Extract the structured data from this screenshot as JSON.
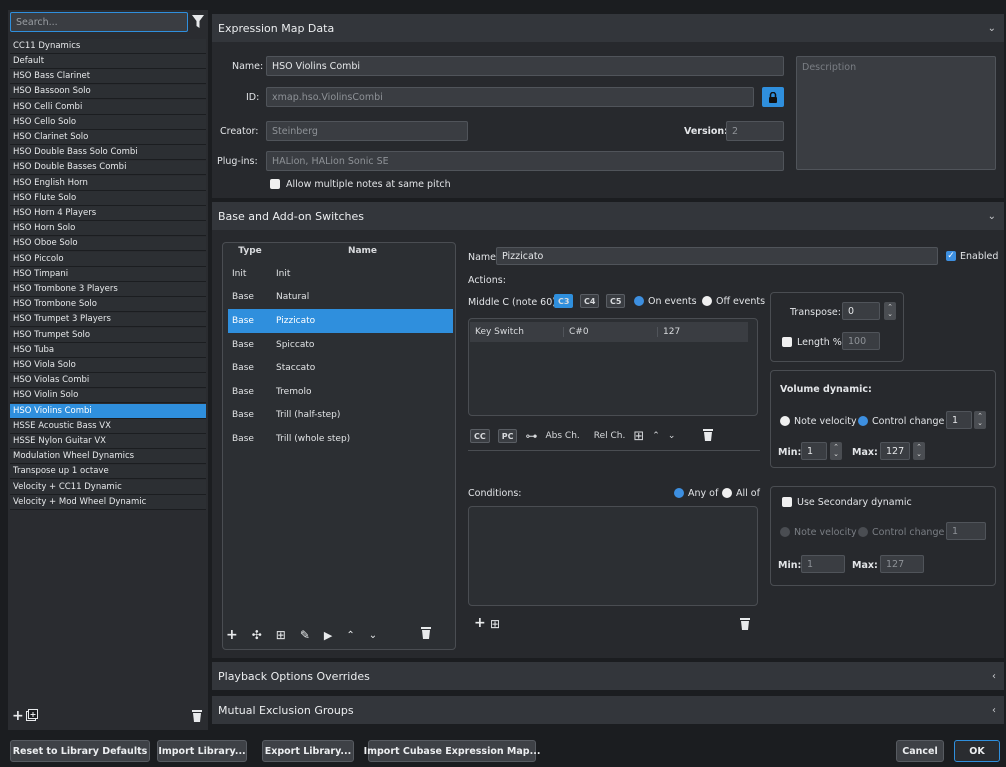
{
  "search": {
    "placeholder": "Search..."
  },
  "library": [
    "CC11 Dynamics",
    "Default",
    "HSO Bass Clarinet",
    "HSO Bassoon Solo",
    "HSO Celli Combi",
    "HSO Cello Solo",
    "HSO Clarinet Solo",
    "HSO Double Bass Solo Combi",
    "HSO Double Basses Combi",
    "HSO English Horn",
    "HSO Flute Solo",
    "HSO Horn 4 Players",
    "HSO Horn Solo",
    "HSO Oboe Solo",
    "HSO Piccolo",
    "HSO Timpani",
    "HSO Trombone 3 Players",
    "HSO Trombone Solo",
    "HSO Trumpet 3 Players",
    "HSO Trumpet Solo",
    "HSO Tuba",
    "HSO Viola Solo",
    "HSO Violas Combi",
    "HSO Violin Solo",
    "HSO Violins Combi",
    "HSSE Acoustic Bass VX",
    "HSSE Nylon Guitar VX",
    "Modulation Wheel Dynamics",
    "Transpose up 1 octave",
    "Velocity + CC11 Dynamic",
    "Velocity + Mod Wheel Dynamic"
  ],
  "selected_library_index": 24,
  "sections": {
    "expression_map_data": "Expression Map Data",
    "base_switches": "Base and Add-on Switches",
    "playback_overrides": "Playback Options Overrides",
    "mutual_exclusion": "Mutual Exclusion Groups"
  },
  "map": {
    "name_label": "Name:",
    "name": "HSO Violins Combi",
    "id_label": "ID:",
    "id": "xmap.hso.ViolinsCombi",
    "creator_label": "Creator:",
    "creator": "Steinberg",
    "version_label": "Version:",
    "version": "2",
    "plugins_label": "Plug-ins:",
    "plugins": "HALion, HALion Sonic SE",
    "allow_multiple": "Allow multiple notes at same pitch",
    "description_placeholder": "Description"
  },
  "switches": {
    "col_type": "Type",
    "col_name": "Name",
    "rows": [
      {
        "type": "Init",
        "name": "Init"
      },
      {
        "type": "Base",
        "name": "Natural"
      },
      {
        "type": "Base",
        "name": "Pizzicato"
      },
      {
        "type": "Base",
        "name": "Spiccato"
      },
      {
        "type": "Base",
        "name": "Staccato"
      },
      {
        "type": "Base",
        "name": "Tremolo"
      },
      {
        "type": "Base",
        "name": "Trill (half-step)"
      },
      {
        "type": "Base",
        "name": "Trill (whole step)"
      }
    ],
    "selected_index": 2
  },
  "detail": {
    "name_label": "Name:",
    "name": "Pizzicato",
    "enabled_label": "Enabled",
    "actions_label": "Actions:",
    "middle_c_label": "Middle C (note 60):",
    "octaves": [
      "C3",
      "C4",
      "C5"
    ],
    "on_events": "On events",
    "off_events": "Off events",
    "action_row": {
      "type": "Key Switch",
      "note": "C#0",
      "value": "127"
    },
    "abs_ch": "Abs Ch.",
    "rel_ch": "Rel Ch.",
    "conditions_label": "Conditions:",
    "any_of": "Any of",
    "all_of": "All of"
  },
  "transpose": {
    "label": "Transpose:",
    "value": "0",
    "length_label": "Length %:",
    "length_value": "100"
  },
  "volume": {
    "title": "Volume dynamic:",
    "note_velocity": "Note velocity",
    "control_change": "Control change",
    "cc_value": "1",
    "min_label": "Min:",
    "min_value": "1",
    "max_label": "Max:",
    "max_value": "127"
  },
  "secondary": {
    "label": "Use Secondary dynamic",
    "note_velocity": "Note velocity",
    "control_change": "Control change",
    "cc_value": "1",
    "min_label": "Min:",
    "min_value": "1",
    "max_label": "Max:",
    "max_value": "127"
  },
  "footer": {
    "reset": "Reset to Library Defaults",
    "import_library": "Import Library...",
    "export_library": "Export Library...",
    "import_cubase": "Import Cubase Expression Map...",
    "cancel": "Cancel",
    "ok": "OK"
  },
  "colors": {
    "accent": "#2f8fdd",
    "background": "#1b1d20",
    "panel": "#33363b"
  }
}
